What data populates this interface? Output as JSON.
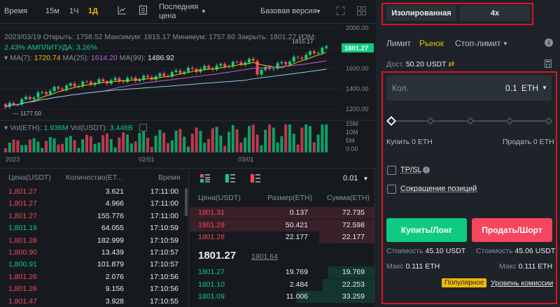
{
  "toolbar": {
    "time_label": "Время",
    "intervals": [
      "15м",
      "1Ч",
      "1Д"
    ],
    "active_interval": "1Д",
    "last_price_label_1": "Последняя",
    "last_price_label_2": "цена",
    "version_label": "Базовая версия"
  },
  "chart": {
    "info_line1": "2023/03/19 Открыть: 1758.52 Максимум: 1815.17 Минимум: 1757.80 Закрыть: 1801.27 ИЗМ:",
    "info_line2_pct": "2.43%",
    "info_line2_amp_label": "АМПЛИТУДА:",
    "info_line2_amp": "3.26%",
    "ma7_label": "MA(7):",
    "ma7": "1720.74",
    "ma25_label": "MA(25):",
    "ma25": "1614.20",
    "ma99_label": "MA(99):",
    "ma99": "1486.92",
    "high_marker": "1815.17",
    "low_marker": "1177.50",
    "current_price": "1801.27",
    "y_ticks": [
      "2000.00",
      "1800.00",
      "1600.00",
      "1400.00",
      "1200.00"
    ],
    "vol_label": "Vol(ETH):",
    "vol_eth": "1.936M",
    "vol_usdt_label": "Vol(USDT):",
    "vol_usdt": "3.446B",
    "vol_ticks": [
      "15M",
      "10M",
      "5M",
      "0.00"
    ],
    "x_ticks": [
      "2023",
      "02/01",
      "03/01"
    ],
    "colors": {
      "up": "#0ecb81",
      "down": "#f6465d",
      "ma7": "#f0b90b",
      "ma25": "#c05fd8",
      "ma99": "#8fc8e8"
    }
  },
  "trades": {
    "headers": [
      "Цена(USDT)",
      "Количество(ЕТ...",
      "Время"
    ],
    "rows": [
      {
        "price": "1,801.27",
        "qty": "3.621",
        "time": "17:11:00",
        "side": "sell"
      },
      {
        "price": "1,801.27",
        "qty": "4.966",
        "time": "17:11:00",
        "side": "sell"
      },
      {
        "price": "1,801.27",
        "qty": "155.776",
        "time": "17:11:00",
        "side": "sell"
      },
      {
        "price": "1,801.19",
        "qty": "64.055",
        "time": "17:10:59",
        "side": "buy"
      },
      {
        "price": "1,801.28",
        "qty": "182.999",
        "time": "17:10:59",
        "side": "sell"
      },
      {
        "price": "1,800.90",
        "qty": "13.439",
        "time": "17:10:57",
        "side": "sell"
      },
      {
        "price": "1,800.91",
        "qty": "101.879",
        "time": "17:10:57",
        "side": "buy"
      },
      {
        "price": "1,801.26",
        "qty": "2.076",
        "time": "17:10:56",
        "side": "sell"
      },
      {
        "price": "1,801.26",
        "qty": "9.156",
        "time": "17:10:56",
        "side": "sell"
      },
      {
        "price": "1,801.47",
        "qty": "3.928",
        "time": "17:10:55",
        "side": "sell"
      }
    ]
  },
  "book": {
    "precision": "0.01",
    "headers": [
      "Цена(USDT)",
      "Размер(ETH)",
      "Сумма(ETH)"
    ],
    "asks": [
      {
        "price": "1801.31",
        "size": "0.137",
        "sum": "72.735",
        "depth": 1.0
      },
      {
        "price": "1801.29",
        "size": "50.421",
        "sum": "72.598",
        "depth": 1.0
      },
      {
        "price": "1801.28",
        "size": "22.177",
        "sum": "22.177",
        "depth": 0.3
      }
    ],
    "last_price": "1801.27",
    "mark_price": "1801.64",
    "bids": [
      {
        "price": "1801.27",
        "size": "19.769",
        "sum": "19.769",
        "depth": 0.25
      },
      {
        "price": "1801.10",
        "size": "2.484",
        "sum": "22.253",
        "depth": 0.28
      },
      {
        "price": "1801.09",
        "size": "11.006",
        "sum": "33.259",
        "depth": 0.42
      }
    ]
  },
  "panel": {
    "margin_mode": "Изолированная",
    "leverage": "4x",
    "tabs": [
      "Лимит",
      "Рынок",
      "Стоп-лимит"
    ],
    "active_tab": "Рынок",
    "available_label": "Дост.",
    "available_value": "50.20 USDT",
    "qty_label": "Кол.",
    "qty_value": "0.1",
    "qty_unit": "ETH",
    "slider_level": 0,
    "buy_avail_label": "Купить 0 ETH",
    "sell_avail_label": "Продать 0 ETH",
    "tpsl_label": "TP/SL",
    "reduce_label": "Сокращение позиций",
    "buy_button": "Купить/Лонг",
    "sell_button": "Продать/Шорт",
    "buy_cost_label": "Стоимость",
    "buy_cost": "45.10 USDT",
    "sell_cost_label": "Стоимость",
    "sell_cost": "45.06 USDT",
    "buy_max_label": "Макс",
    "buy_max": "0.111 ETH",
    "sell_max_label": "Макс",
    "sell_max": "0.111 ETH",
    "popular_badge": "Популярное",
    "fee_link": "Уровень комиссии",
    "colors": {
      "buy": "#0ecb81",
      "sell": "#f6465d",
      "highlight": "#e0141e"
    }
  }
}
